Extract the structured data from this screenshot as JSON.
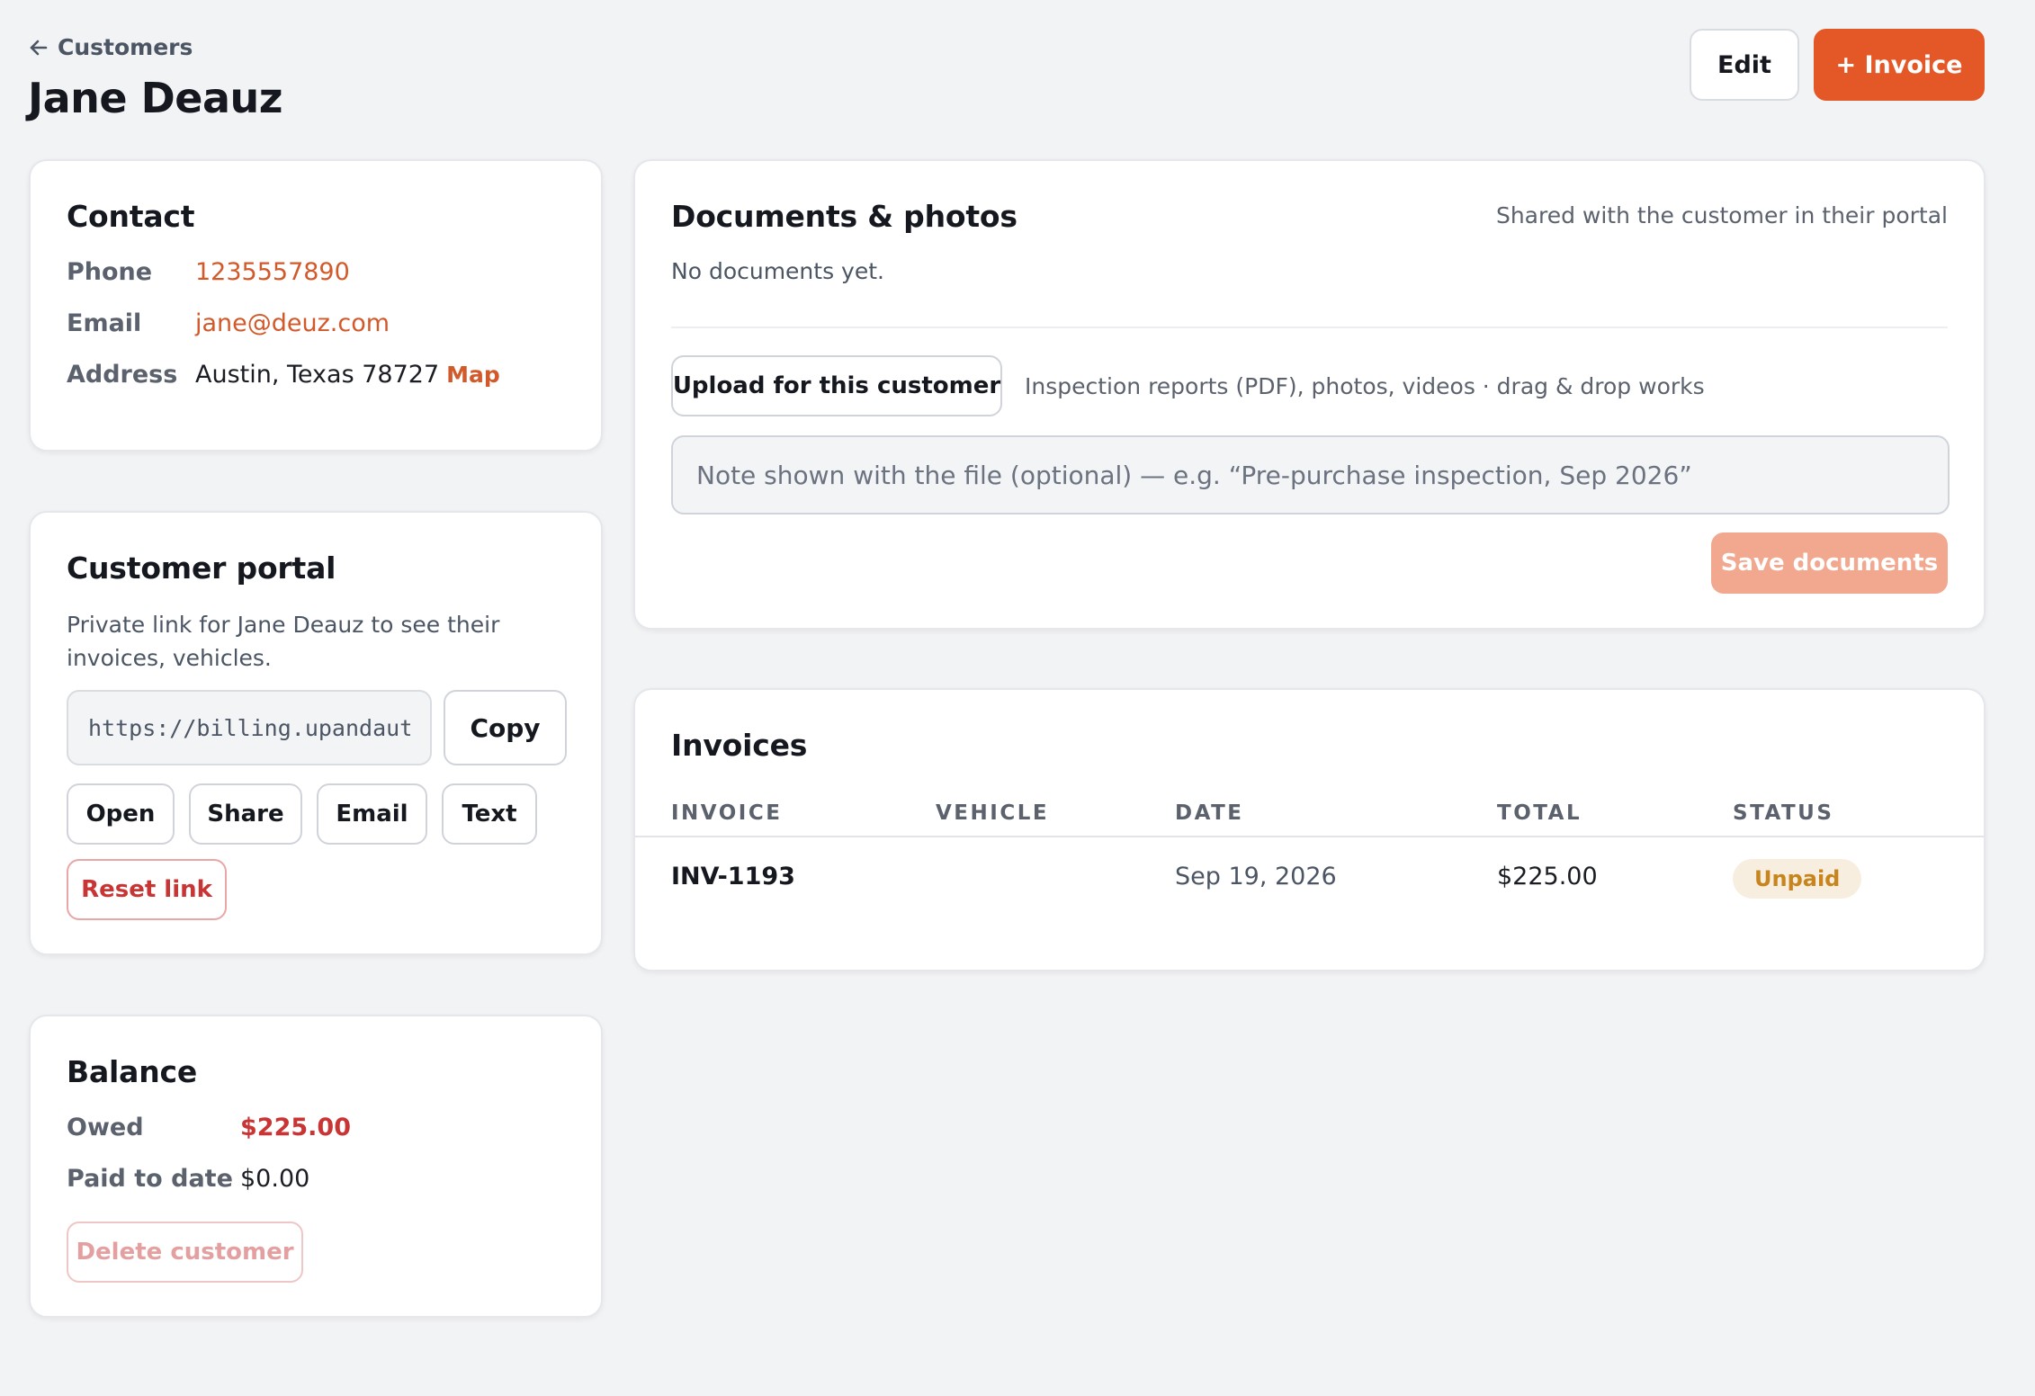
{
  "header": {
    "breadcrumb_label": "Customers",
    "title": "Jane Deauz",
    "edit_label": "Edit",
    "invoice_label": "+ Invoice"
  },
  "contact": {
    "title": "Contact",
    "phone_label": "Phone",
    "phone_value": "1235557890",
    "email_label": "Email",
    "email_value": "jane@deuz.com",
    "address_label": "Address",
    "address_value": "Austin, Texas 78727",
    "map_label": "Map"
  },
  "portal": {
    "title": "Customer portal",
    "description": "Private link for Jane Deauz to see their invoices, vehicles.",
    "url_value": "https://billing.upandaut",
    "copy_label": "Copy",
    "open_label": "Open",
    "share_label": "Share",
    "email_label": "Email",
    "text_label": "Text",
    "reset_label": "Reset link"
  },
  "balance": {
    "title": "Balance",
    "owed_label": "Owed",
    "owed_value": "$225.00",
    "paid_label": "Paid to date",
    "paid_value": "$0.00",
    "delete_label": "Delete customer"
  },
  "documents": {
    "title": "Documents & photos",
    "shared_note": "Shared with the customer in their portal",
    "empty_text": "No documents yet.",
    "upload_label": "Upload for this customer",
    "upload_hint": "Inspection reports (PDF), photos, videos · drag & drop works",
    "note_placeholder": "Note shown with the file (optional) — e.g. “Pre-purchase inspection, Sep 2026”",
    "save_label": "Save documents"
  },
  "invoices": {
    "title": "Invoices",
    "columns": [
      "INVOICE",
      "VEHICLE",
      "DATE",
      "TOTAL",
      "STATUS"
    ],
    "rows": [
      {
        "invoice": "INV-1193",
        "vehicle": "",
        "date": "Sep 19, 2026",
        "total": "$225.00",
        "status": "Unpaid"
      }
    ]
  },
  "colors": {
    "accent": "#e45726",
    "danger": "#c93535",
    "status_unpaid_bg": "#f7eee0",
    "status_unpaid_fg": "#c8841d"
  },
  "icons": {
    "back": "arrow-left-icon"
  }
}
